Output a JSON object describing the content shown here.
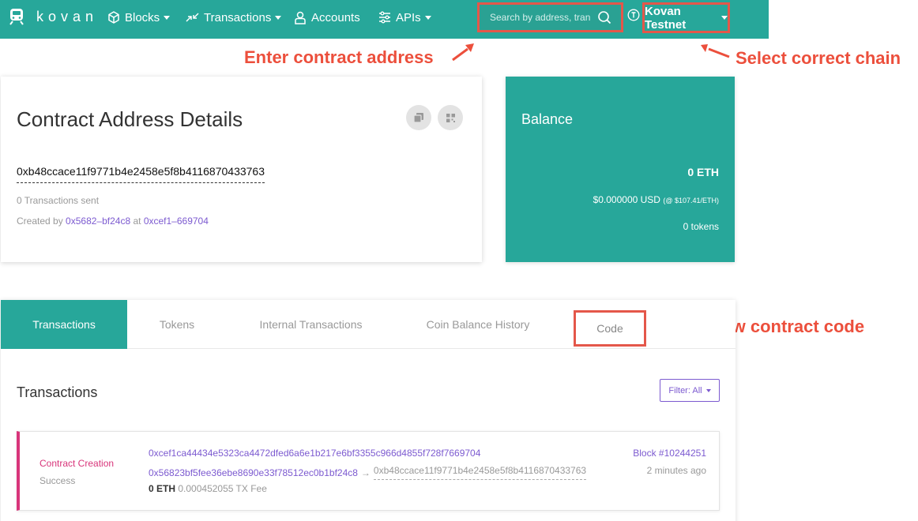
{
  "navbar": {
    "brand": "kovan",
    "items": [
      {
        "label": "Blocks",
        "icon": "cube-icon",
        "dropdown": true
      },
      {
        "label": "Transactions",
        "icon": "transfer-icon",
        "dropdown": true
      },
      {
        "label": "Accounts",
        "icon": "user-icon",
        "dropdown": false
      },
      {
        "label": "APIs",
        "icon": "sliders-icon",
        "dropdown": true
      }
    ],
    "search_placeholder": "Search by address, tran",
    "chain_label": "Kovan Testnet"
  },
  "annotations": {
    "enter_address": "Enter contract address",
    "select_chain": "Select correct chain",
    "view_code": "View contract code"
  },
  "details": {
    "title": "Contract Address Details",
    "address": "0xb48ccace11f9771b4e2458e5f8b4116870433763",
    "tx_sent": "0 Transactions sent",
    "created_by_prefix": "Created by",
    "creator": "0x5682–bf24c8",
    "at_text": "at",
    "creation_tx": "0xcef1–669704"
  },
  "balance": {
    "title": "Balance",
    "eth": "0 ETH",
    "usd": "$0.000000 USD",
    "usd_rate": "(@ $107.41/ETH)",
    "tokens": "0 tokens"
  },
  "tabs": [
    "Transactions",
    "Tokens",
    "Internal Transactions",
    "Coin Balance History",
    "Code"
  ],
  "transactions": {
    "title": "Transactions",
    "filter_label": "Filter: All",
    "rows": [
      {
        "type": "Contract Creation",
        "status": "Success",
        "hash": "0xcef1ca44434e5323ca4472dfed6a6e1b217e6bf3355c966d4855f728f7669704",
        "from": "0x56823bf5fee36ebe8690e33f78512ec0b1bf24c8",
        "arrow": "→",
        "to": "0xb48ccace11f9771b4e2458e5f8b4116870433763",
        "value": "0 ETH",
        "fee": "0.000452055 TX Fee",
        "block": "Block #10244251",
        "time": "2 minutes ago"
      }
    ]
  },
  "colors": {
    "teal": "#27a79a",
    "annotation_red": "#ec4f3c",
    "link_purple": "#7c5ad0",
    "creation_pink": "#d8357a"
  }
}
